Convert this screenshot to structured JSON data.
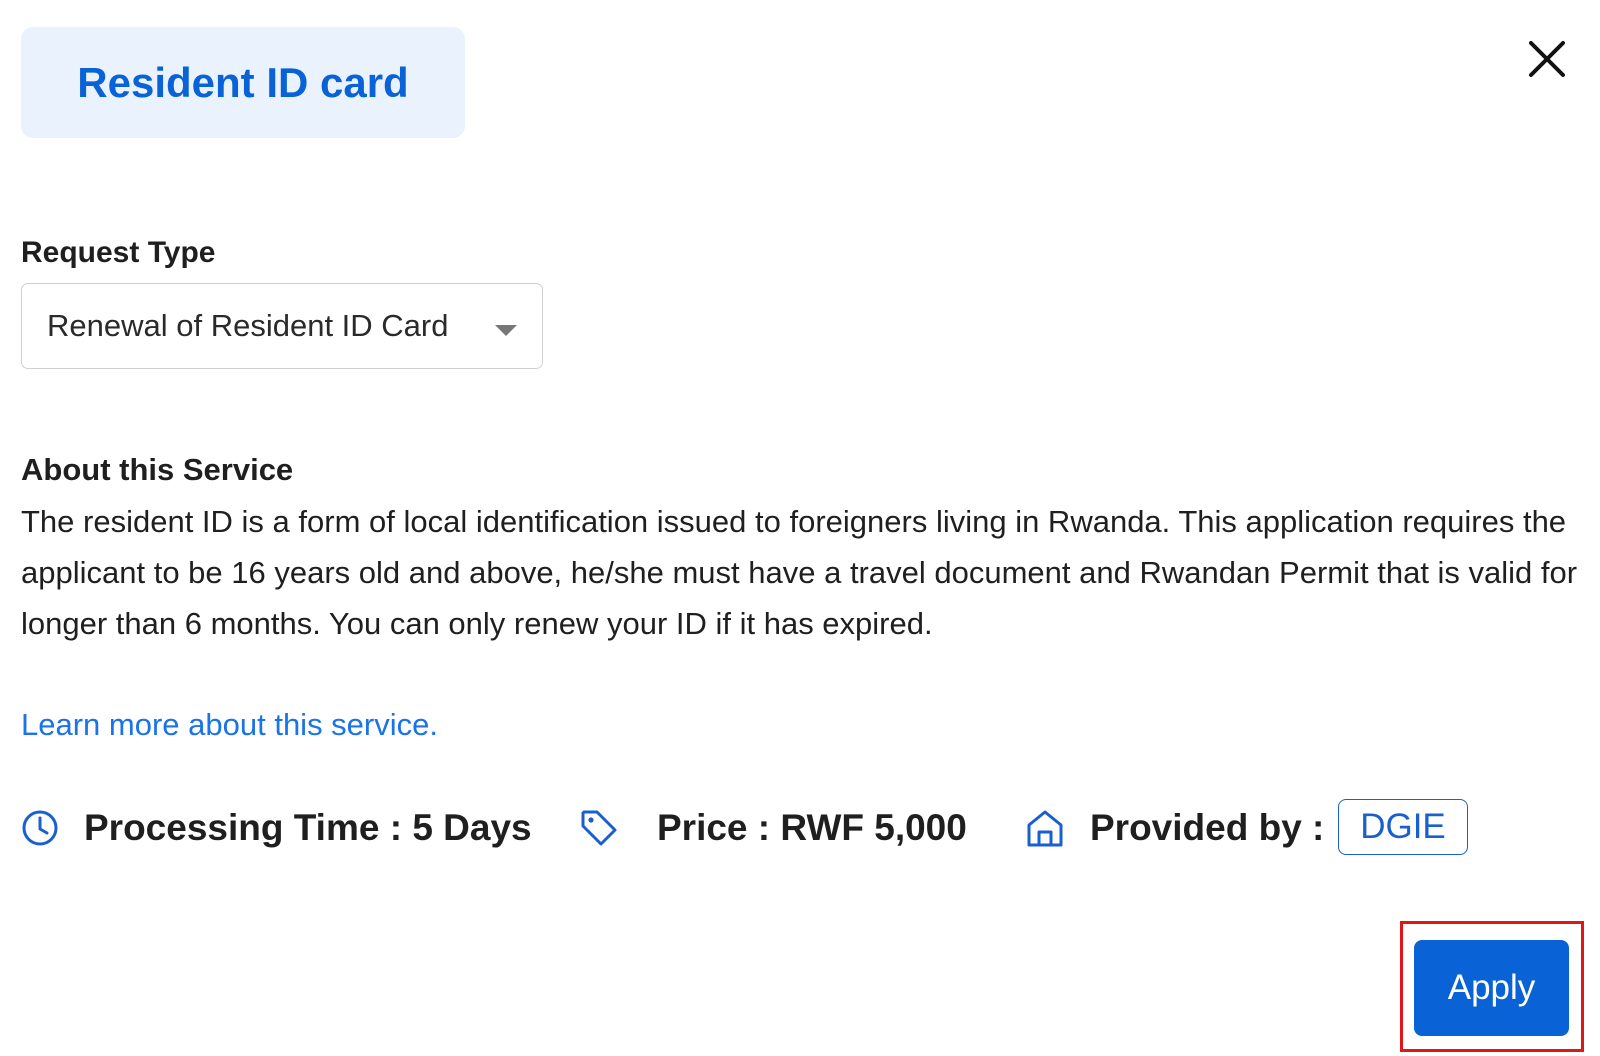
{
  "header": {
    "title": "Resident ID card",
    "close_icon": "close-icon"
  },
  "request_type": {
    "label": "Request Type",
    "selected_value": "Renewal of Resident ID Card",
    "dropdown_icon": "caret-down-icon"
  },
  "about": {
    "heading": "About this Service",
    "description": "The resident ID is a form of local identification issued to foreigners living in Rwanda. This application requires the applicant to be 16 years old and above, he/she must have a travel document and Rwandan Permit that is valid for longer than 6 months. You can only renew your ID if it has expired.",
    "learn_more_link": "Learn more about this service."
  },
  "details": {
    "processing_time": {
      "icon": "clock-icon",
      "text": "Processing Time : 5 Days"
    },
    "price": {
      "icon": "price-tag-icon",
      "text": "Price : RWF 5,000"
    },
    "provider": {
      "icon": "home-icon",
      "label": "Provided by :",
      "value": "DGIE"
    }
  },
  "actions": {
    "apply_label": "Apply"
  },
  "colors": {
    "primary": "#0a63d6",
    "link": "#1a73e8",
    "title_bg": "#eaf3fd",
    "highlight": "#e01717"
  }
}
